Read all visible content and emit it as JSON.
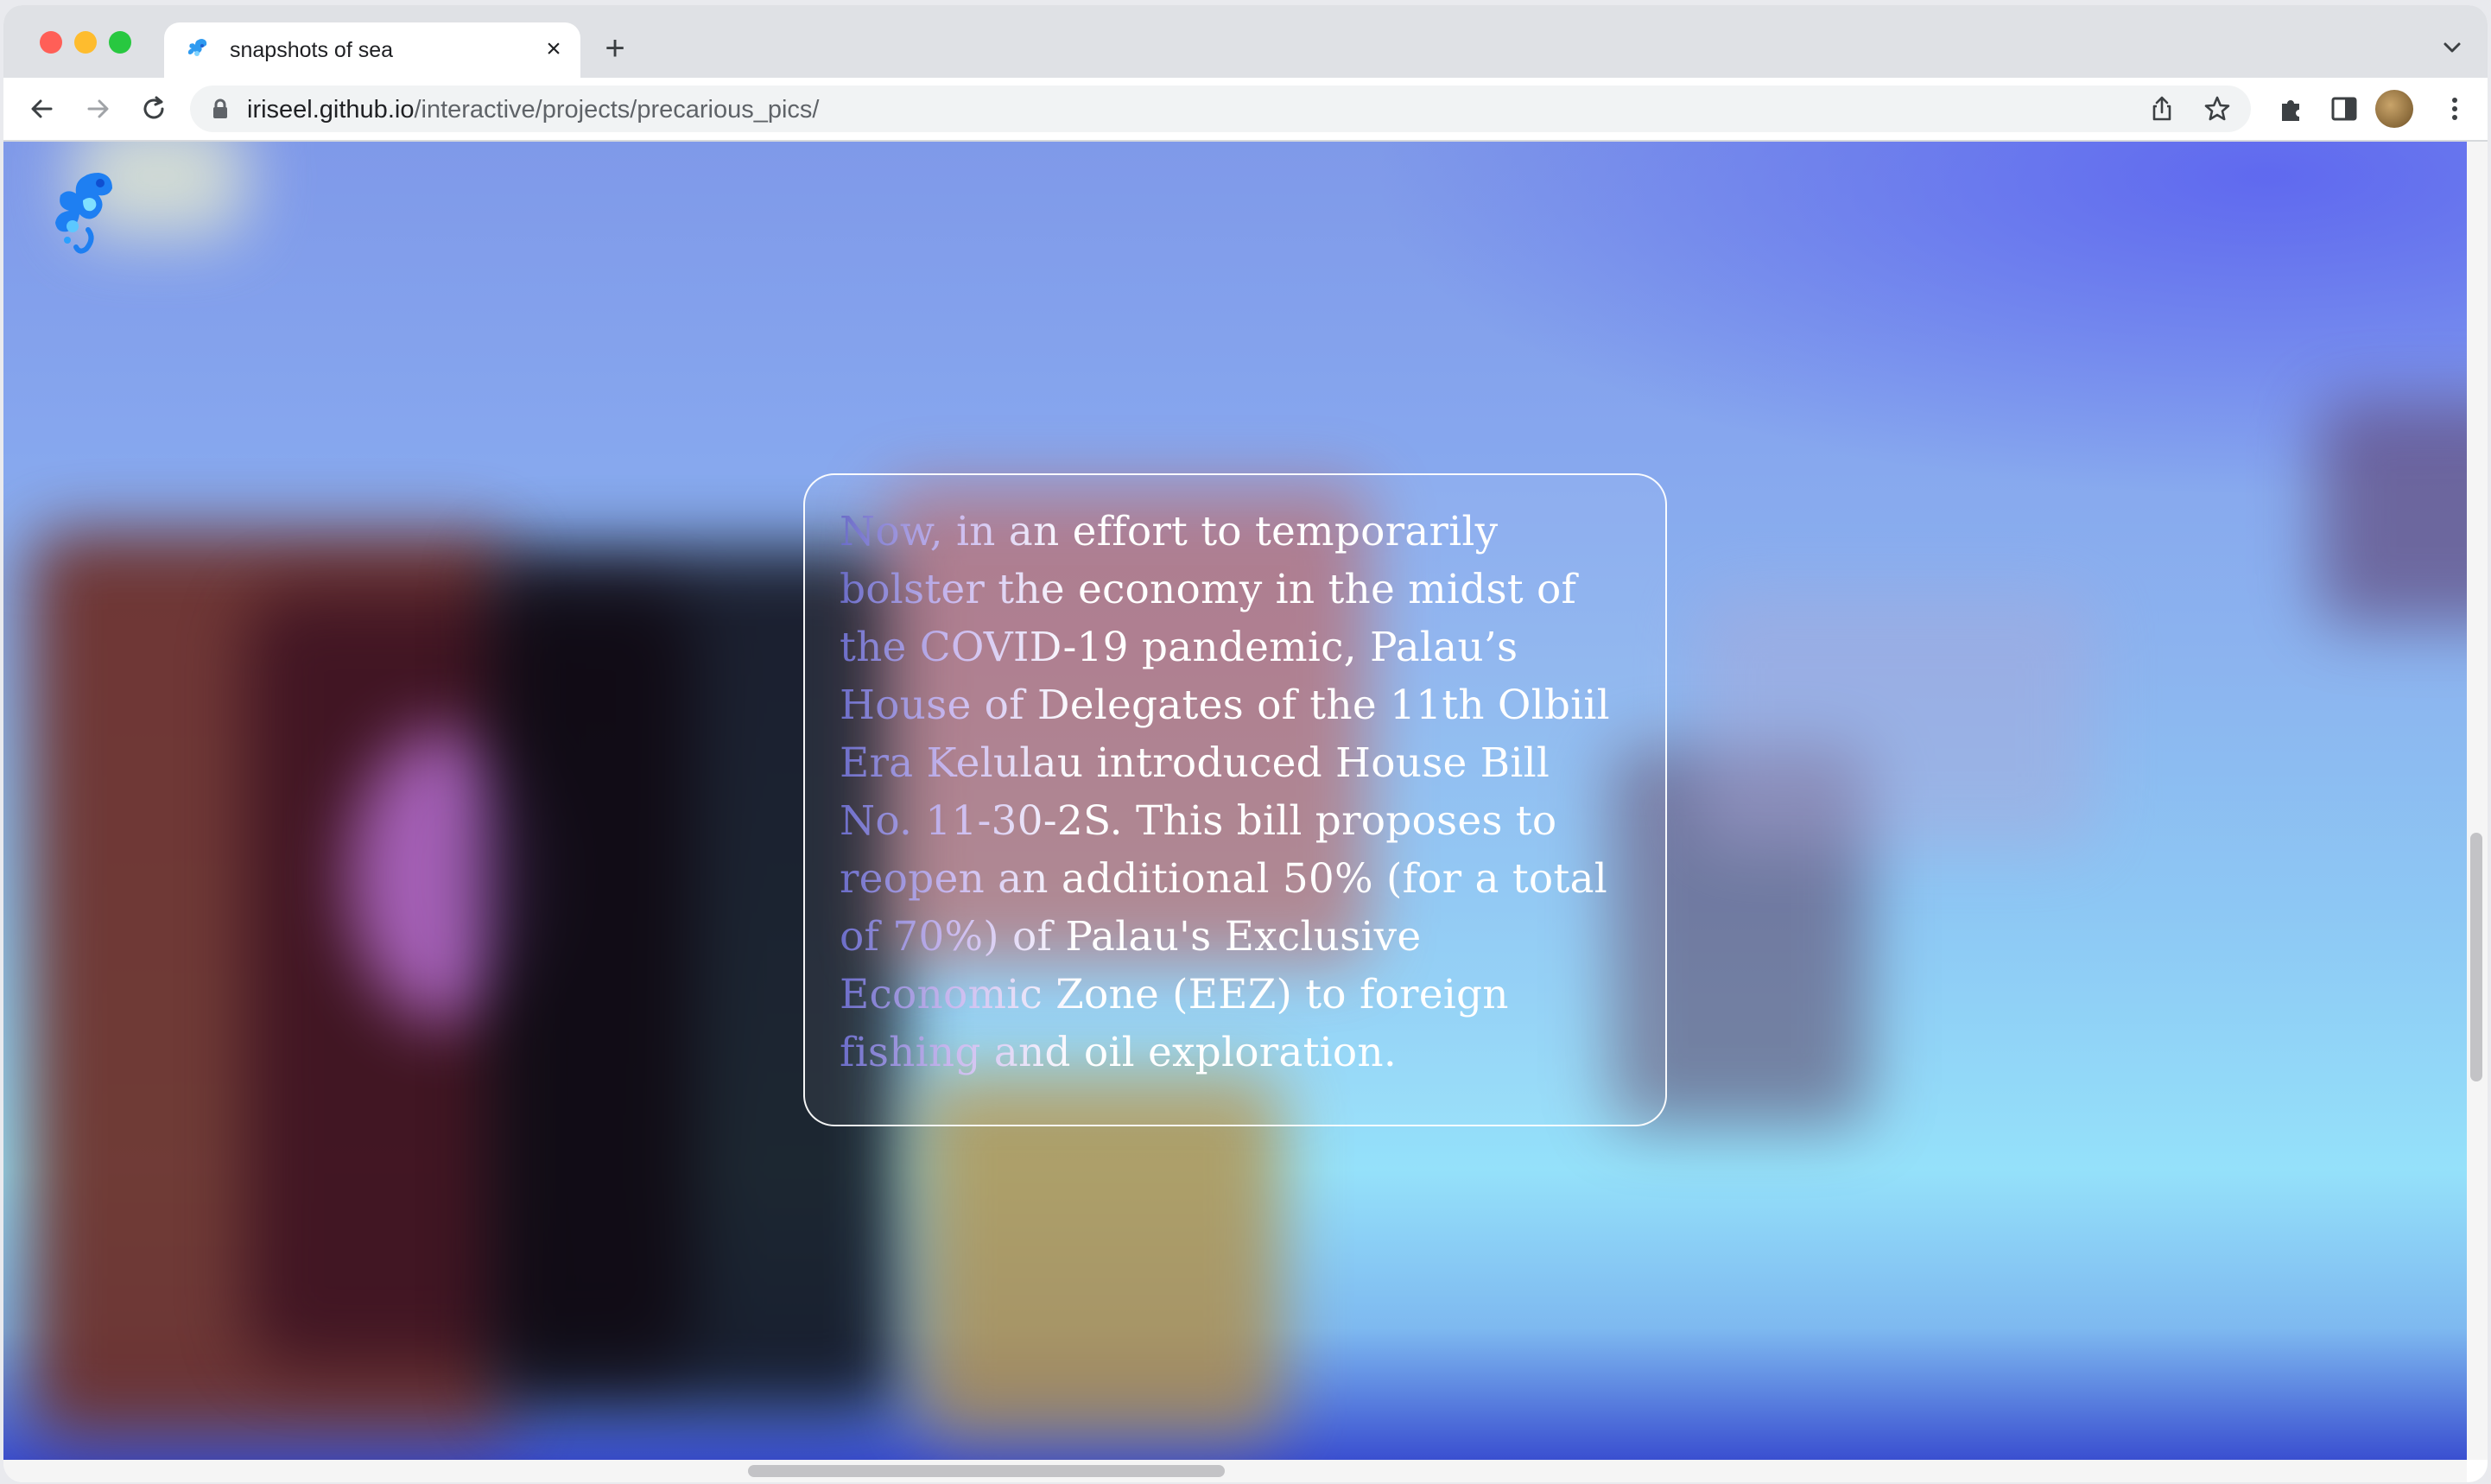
{
  "browser": {
    "tab": {
      "title": "snapshots of sea",
      "favicon": "sea-creature-icon"
    },
    "address_bar": {
      "host": "iriseel.github.io",
      "path": "/interactive/projects/precarious_pics/"
    }
  },
  "page": {
    "logo": "sea-creature-logo",
    "card_text": "Now, in an effort to temporarily bolster the economy in the midst of the COVID-19 pandemic, Palau’s House of Delegates of the 11th Olbiil Era Kelulau introduced House Bill No. 11-30-2S. This bill proposes to reopen an additional 50% (for a total of 70%) of Palau's Exclusive Economic Zone (EEZ) to foreign fishing and oil exploration."
  },
  "colors": {
    "accent_blue": "#5c64f0",
    "sky_cyan": "#95e1fa",
    "card_border": "#ffffff"
  }
}
